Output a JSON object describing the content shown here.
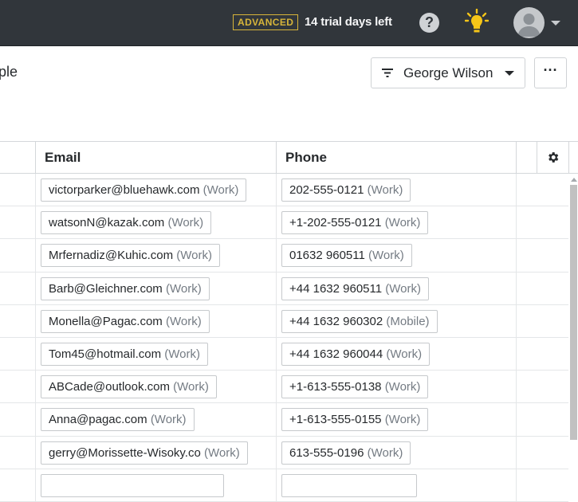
{
  "topbar": {
    "plan_badge": "ADVANCED",
    "trial_text": "14 trial days left",
    "help_glyph": "?"
  },
  "header": {
    "title_fragment": "ple",
    "filter_label": "George Wilson",
    "more_glyph": "···"
  },
  "table": {
    "columns": [
      "Email",
      "Phone"
    ],
    "rows": [
      {
        "email": "victorparker@bluehawk.com",
        "email_label": "(Work)",
        "phone": "202-555-0121",
        "phone_label": "(Work)"
      },
      {
        "email": "watsonN@kazak.com",
        "email_label": "(Work)",
        "phone": "+1-202-555-0121",
        "phone_label": "(Work)"
      },
      {
        "email": "Mrfernadiz@Kuhic.com",
        "email_label": "(Work)",
        "phone": "01632 960511",
        "phone_label": "(Work)"
      },
      {
        "email": "Barb@Gleichner.com",
        "email_label": "(Work)",
        "phone": "+44 1632 960511",
        "phone_label": "(Work)"
      },
      {
        "email": "Monella@Pagac.com",
        "email_label": "(Work)",
        "phone": "+44 1632 960302",
        "phone_label": "(Mobile)"
      },
      {
        "email": "Tom45@hotmail.com",
        "email_label": "(Work)",
        "phone": "+44 1632 960044",
        "phone_label": "(Work)"
      },
      {
        "email": "ABCade@outlook.com",
        "email_label": "(Work)",
        "phone": "+1-613-555-0138",
        "phone_label": "(Work)"
      },
      {
        "email": "Anna@pagac.com",
        "email_label": "(Work)",
        "phone": "+1-613-555-0155",
        "phone_label": "(Work)"
      },
      {
        "email": "gerry@Morissette-Wisoky.co",
        "email_label": "(Work)",
        "phone": "613-555-0196",
        "phone_label": "(Work)"
      }
    ]
  },
  "colors": {
    "topbar_bg": "#31363b",
    "badge": "#d7b53a",
    "bulb": "#f5c518"
  },
  "icons": {
    "help": "help-icon",
    "bulb": "lightbulb-icon",
    "avatar": "user-avatar-icon",
    "filter": "filter-icon",
    "settings": "gear-icon"
  }
}
